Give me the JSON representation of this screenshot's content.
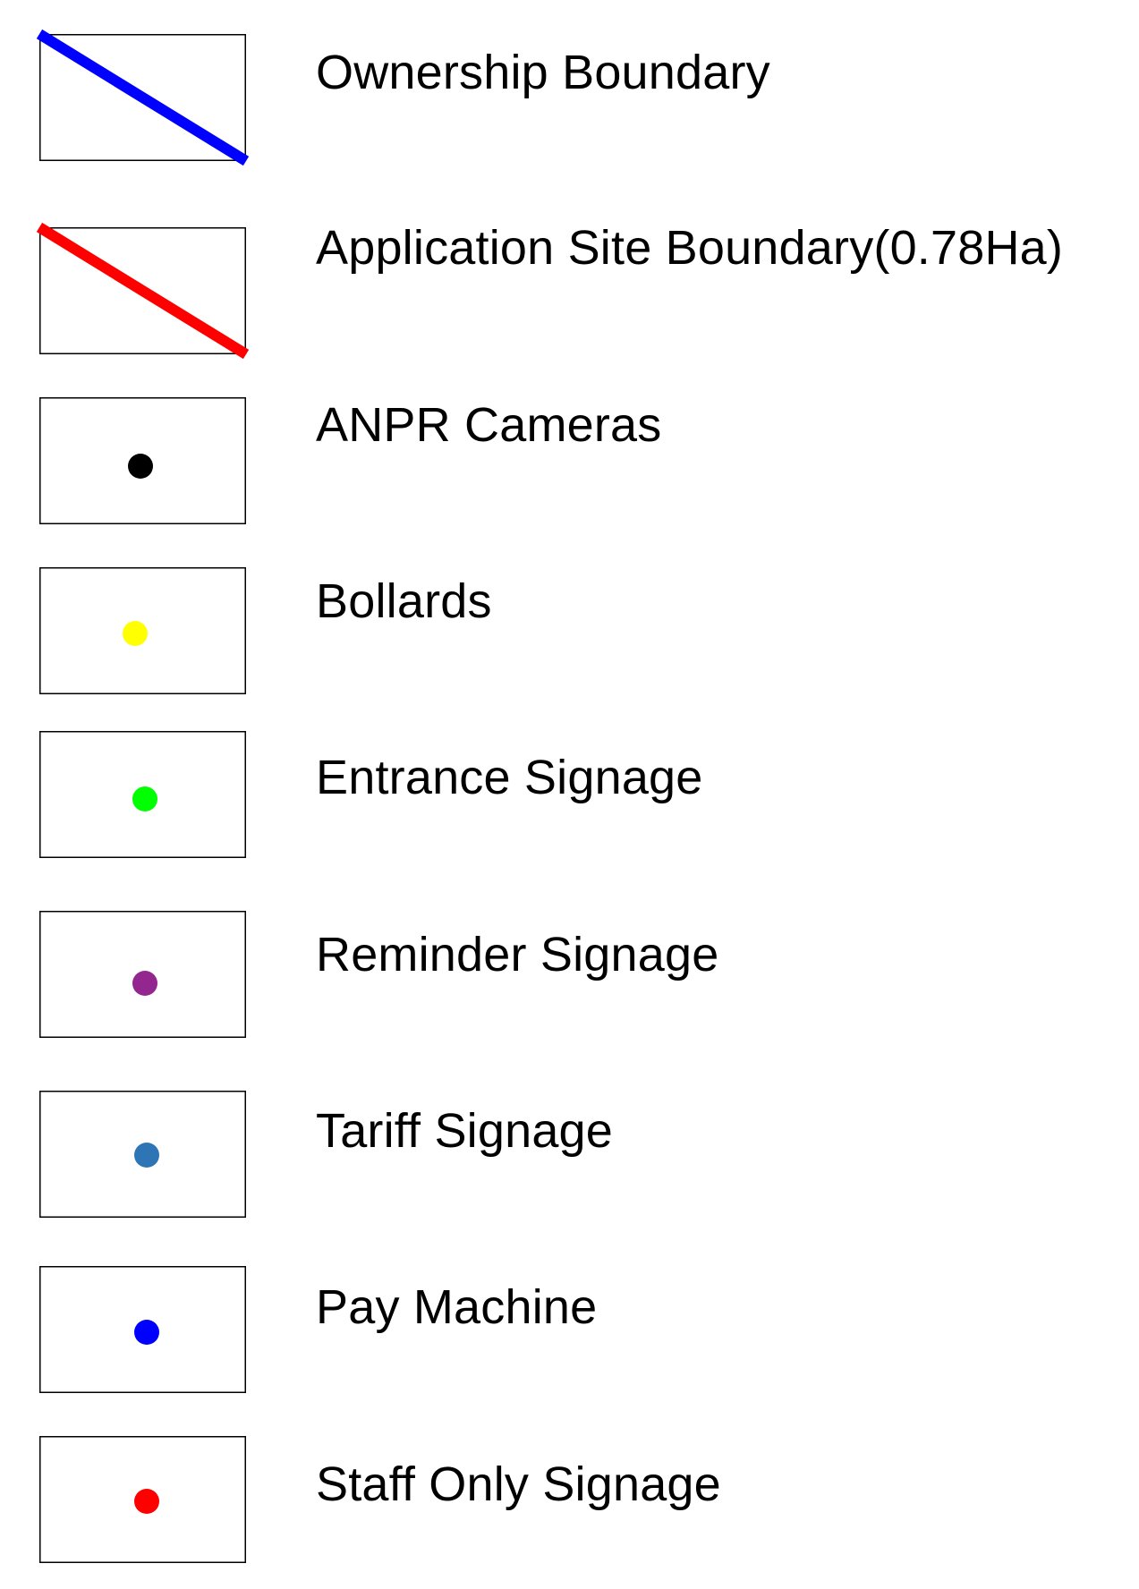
{
  "legend": {
    "items": [
      {
        "label": "Ownership Boundary",
        "symbol": "diagonal-line",
        "color": "#0000ff"
      },
      {
        "label": "Application Site Boundary(0.78Ha)",
        "symbol": "diagonal-line",
        "color": "#ff0000"
      },
      {
        "label": "ANPR Cameras",
        "symbol": "dot",
        "color": "#000000"
      },
      {
        "label": "Bollards",
        "symbol": "dot",
        "color": "#ffff00"
      },
      {
        "label": "Entrance Signage",
        "symbol": "dot",
        "color": "#00ff00"
      },
      {
        "label": "Reminder Signage",
        "symbol": "dot",
        "color": "#93278f"
      },
      {
        "label": "Tariff Signage",
        "symbol": "dot",
        "color": "#2e75b6"
      },
      {
        "label": "Pay Machine",
        "symbol": "dot",
        "color": "#0000ff"
      },
      {
        "label": "Staff Only Signage",
        "symbol": "dot",
        "color": "#ff0000"
      }
    ]
  }
}
